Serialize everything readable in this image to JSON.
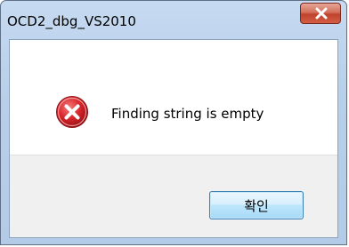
{
  "window": {
    "title": "OCD2_dbg_VS2010"
  },
  "dialog": {
    "message": "Finding string is empty",
    "icon": "error-icon",
    "ok_label": "확인"
  },
  "colors": {
    "error_red": "#d8262c",
    "close_red": "#c0432c",
    "button_blue": "#3c7fb1"
  }
}
